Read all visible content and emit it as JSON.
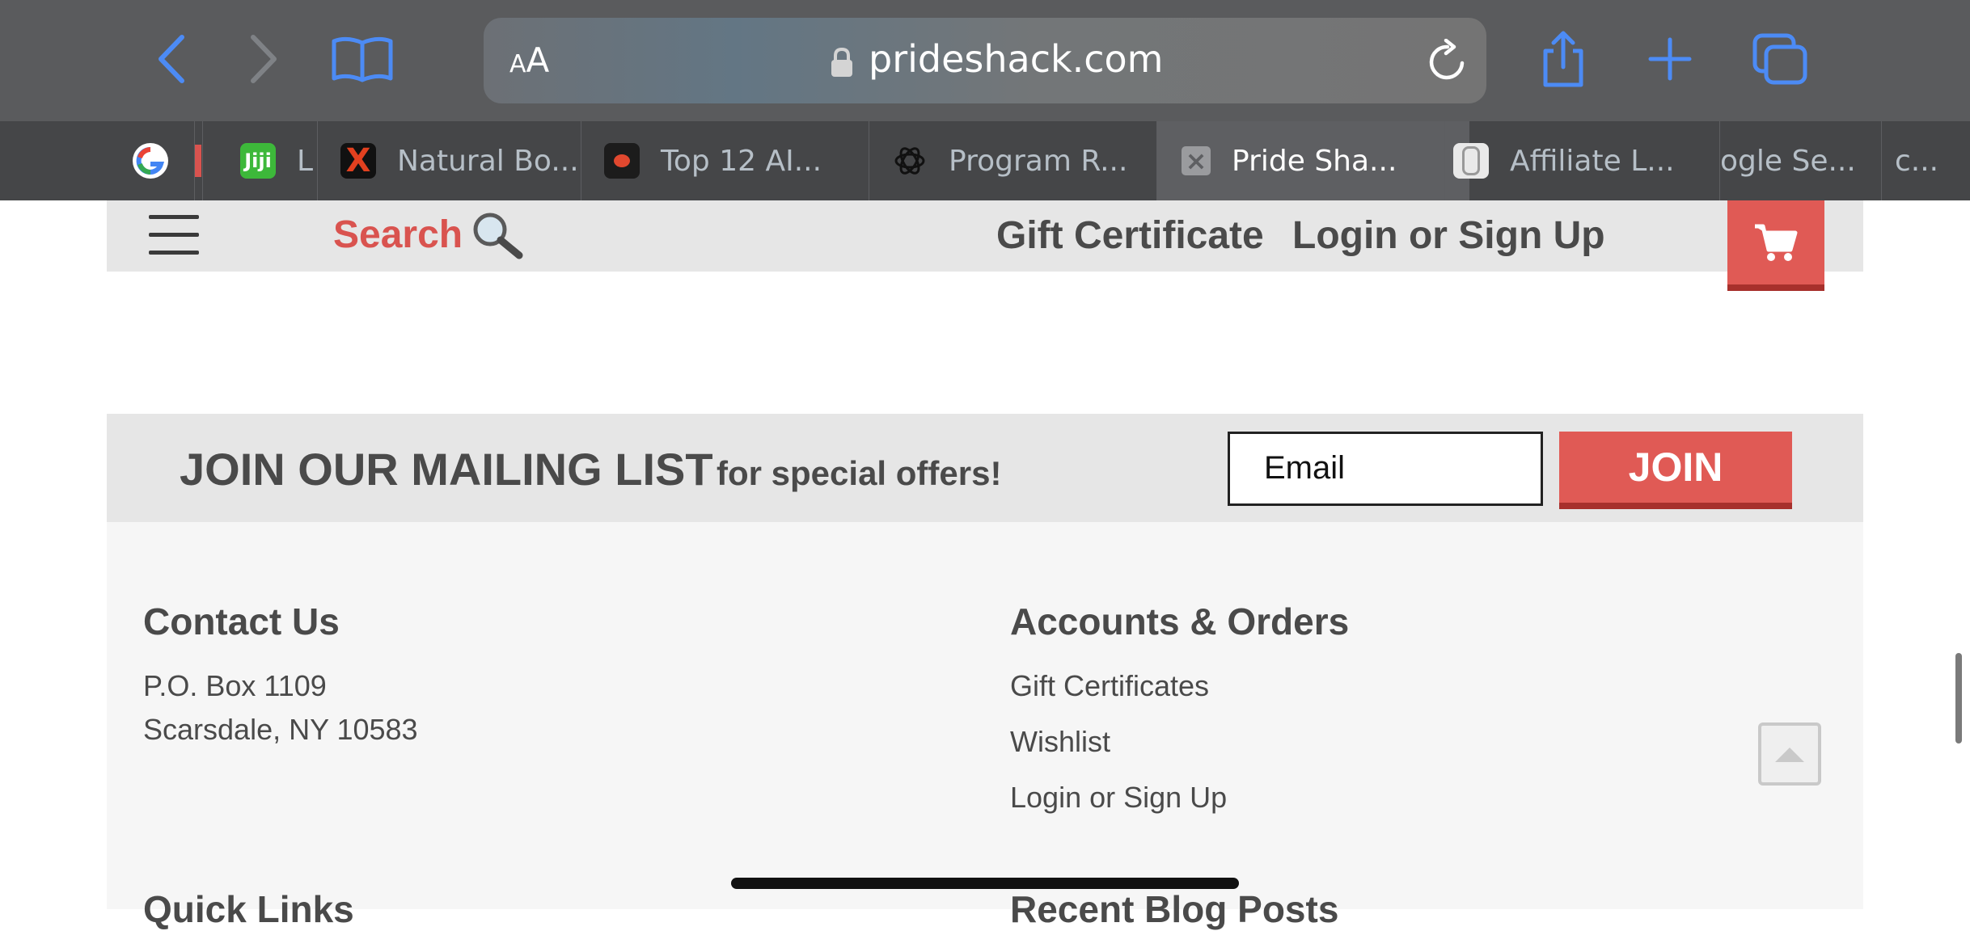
{
  "browser": {
    "aa_small": "A",
    "aa_big": "A",
    "url": "prideshack.com",
    "accent": "#4c8bf5"
  },
  "tabs": [
    {
      "label": "",
      "icon": "google-icon"
    },
    {
      "label": "",
      "icon": "partial-favicon"
    },
    {
      "label": "L",
      "icon": "jiji-icon",
      "icon_text": "Jiji"
    },
    {
      "label": "Natural Bo...",
      "icon": "x-brand-icon",
      "icon_text": "X"
    },
    {
      "label": "Top 12 AI...",
      "icon": "ai-site-icon"
    },
    {
      "label": "Program R...",
      "icon": "openai-icon"
    },
    {
      "label": "Pride Sha...",
      "icon": "close-icon",
      "icon_text": "×"
    },
    {
      "label": "Affiliate L...",
      "icon": "affiliate-icon"
    },
    {
      "label": "ogle Se...",
      "icon": ""
    },
    {
      "label": "c...",
      "icon": ""
    }
  ],
  "header": {
    "search_label": "Search",
    "gift_certificate": "Gift Certificate",
    "login": "Login or Sign Up"
  },
  "mailing": {
    "title": "JOIN OUR MAILING LIST",
    "subtitle": "for special offers!",
    "email_placeholder": "Email",
    "join_label": "JOIN"
  },
  "footer": {
    "contact": {
      "heading": "Contact Us",
      "line1": "P.O. Box 1109",
      "line2": "Scarsdale, NY 10583"
    },
    "accounts": {
      "heading": "Accounts & Orders",
      "links": [
        "Gift Certificates",
        "Wishlist",
        "Login or Sign Up"
      ]
    },
    "quick_links_heading": "Quick Links",
    "blog_heading": "Recent Blog Posts"
  },
  "colors": {
    "brand_red": "#e05a55",
    "brand_dark_red": "#a7302c",
    "text_gray": "#4a4a4a"
  }
}
